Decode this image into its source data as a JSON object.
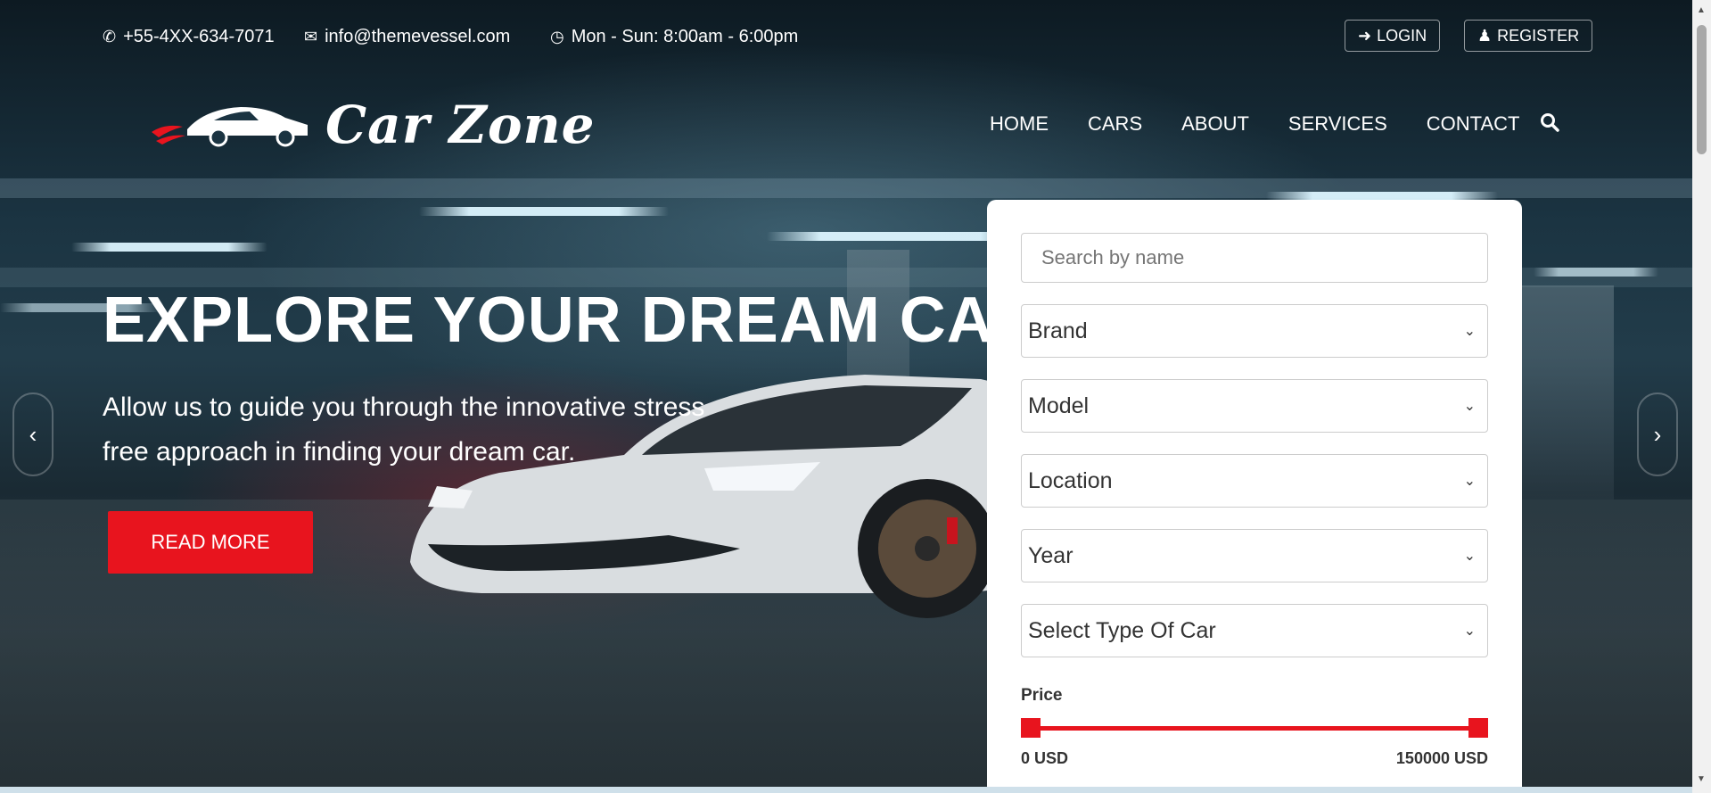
{
  "topbar": {
    "phone": "+55-4XX-634-7071",
    "email": "info@themevessel.com",
    "hours": "Mon - Sun: 8:00am - 6:00pm",
    "login_label": "LOGIN",
    "register_label": "REGISTER",
    "icons": {
      "phone": "phone-icon",
      "email": "envelope-icon",
      "hours": "clock-icon",
      "login": "sign-in-icon",
      "register": "user-icon"
    }
  },
  "logo": {
    "text": "Car Zone"
  },
  "nav": {
    "items": [
      "HOME",
      "CARS",
      "ABOUT",
      "SERVICES",
      "CONTACT"
    ],
    "search_icon": "search-icon"
  },
  "hero": {
    "headline": "EXPLORE YOUR DREAM CAR",
    "subtext": "Allow us to guide you through the innovative stress free approach in finding your dream car.",
    "cta_label": "READ MORE"
  },
  "search_form": {
    "name_placeholder": "Search by name",
    "selects": [
      "Brand",
      "Model",
      "Location",
      "Year",
      "Select Type Of Car"
    ],
    "price_label": "Price",
    "price_min": "0 USD",
    "price_max": "150000 USD",
    "price_range_fraction": [
      0,
      1
    ]
  },
  "colors": {
    "accent": "#e8141e",
    "text_light": "#ffffff",
    "card_bg": "#ffffff"
  }
}
